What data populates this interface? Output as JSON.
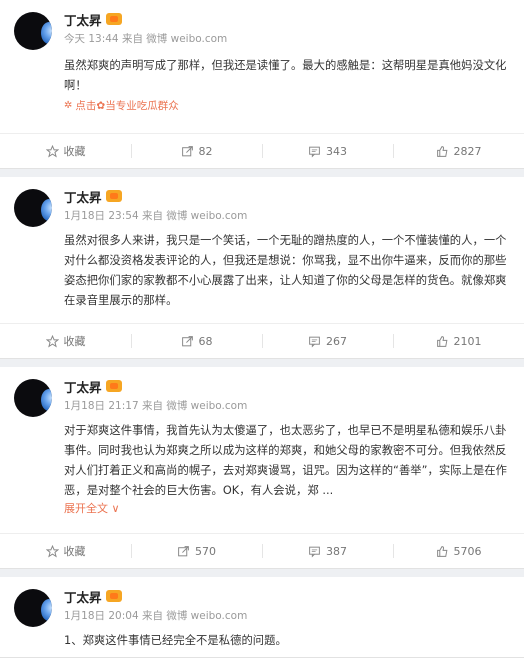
{
  "posts": [
    {
      "author": "丁太昇",
      "time": "今天 13:44",
      "source": "来自 微博 weibo.com",
      "text": "虽然郑爽的声明写成了那样，但我还是读懂了。最大的感触是：这帮明星是真他妈没文化啊！",
      "tag": "点击✿当专业吃瓜群众",
      "actions": {
        "favorite": "收藏",
        "repost": "82",
        "comment": "343",
        "like": "2827"
      }
    },
    {
      "author": "丁太昇",
      "time": "1月18日 23:54",
      "source": "来自 微博 weibo.com",
      "text": "虽然对很多人来讲，我只是一个笑话，一个无耻的蹭热度的人，一个不懂装懂的人，一个对什么都没资格发表评论的人，但我还是想说：你骂我，显不出你牛逼来，反而你的那些姿态把你们家的家教都不小心展露了出来，让人知道了你的父母是怎样的货色。就像郑爽在录音里展示的那样。",
      "actions": {
        "favorite": "收藏",
        "repost": "68",
        "comment": "267",
        "like": "2101"
      }
    },
    {
      "author": "丁太昇",
      "time": "1月18日 21:17",
      "source": "来自 微博 weibo.com",
      "text": "对于郑爽这件事情，我首先认为太傻逼了，也太恶劣了，也早已不是明星私德和娱乐八卦事件。同时我也认为郑爽之所以成为这样的郑爽，和她父母的家教密不可分。但我依然反对人们打着正义和高尚的幌子，去对郑爽谩骂，诅咒。因为这样的“善举”，实际上是在作恶，是对整个社会的巨大伤害。OK，有人会说，郑 ...",
      "more": "展开全文 ∨",
      "actions": {
        "favorite": "收藏",
        "repost": "570",
        "comment": "387",
        "like": "5706"
      }
    },
    {
      "author": "丁太昇",
      "time": "1月18日 20:04",
      "source": "来自 微博 weibo.com",
      "text": "1、郑爽这件事情已经完全不是私德的问题。",
      "actions": {
        "favorite": "收藏",
        "repost": "",
        "comment": "",
        "like": ""
      }
    }
  ],
  "colors": {
    "accent": "#eb7350",
    "background": "#eef0f3"
  },
  "icons": {
    "favorite": "star-icon",
    "repost": "repost-icon",
    "comment": "comment-icon",
    "like": "thumbs-up-icon"
  }
}
